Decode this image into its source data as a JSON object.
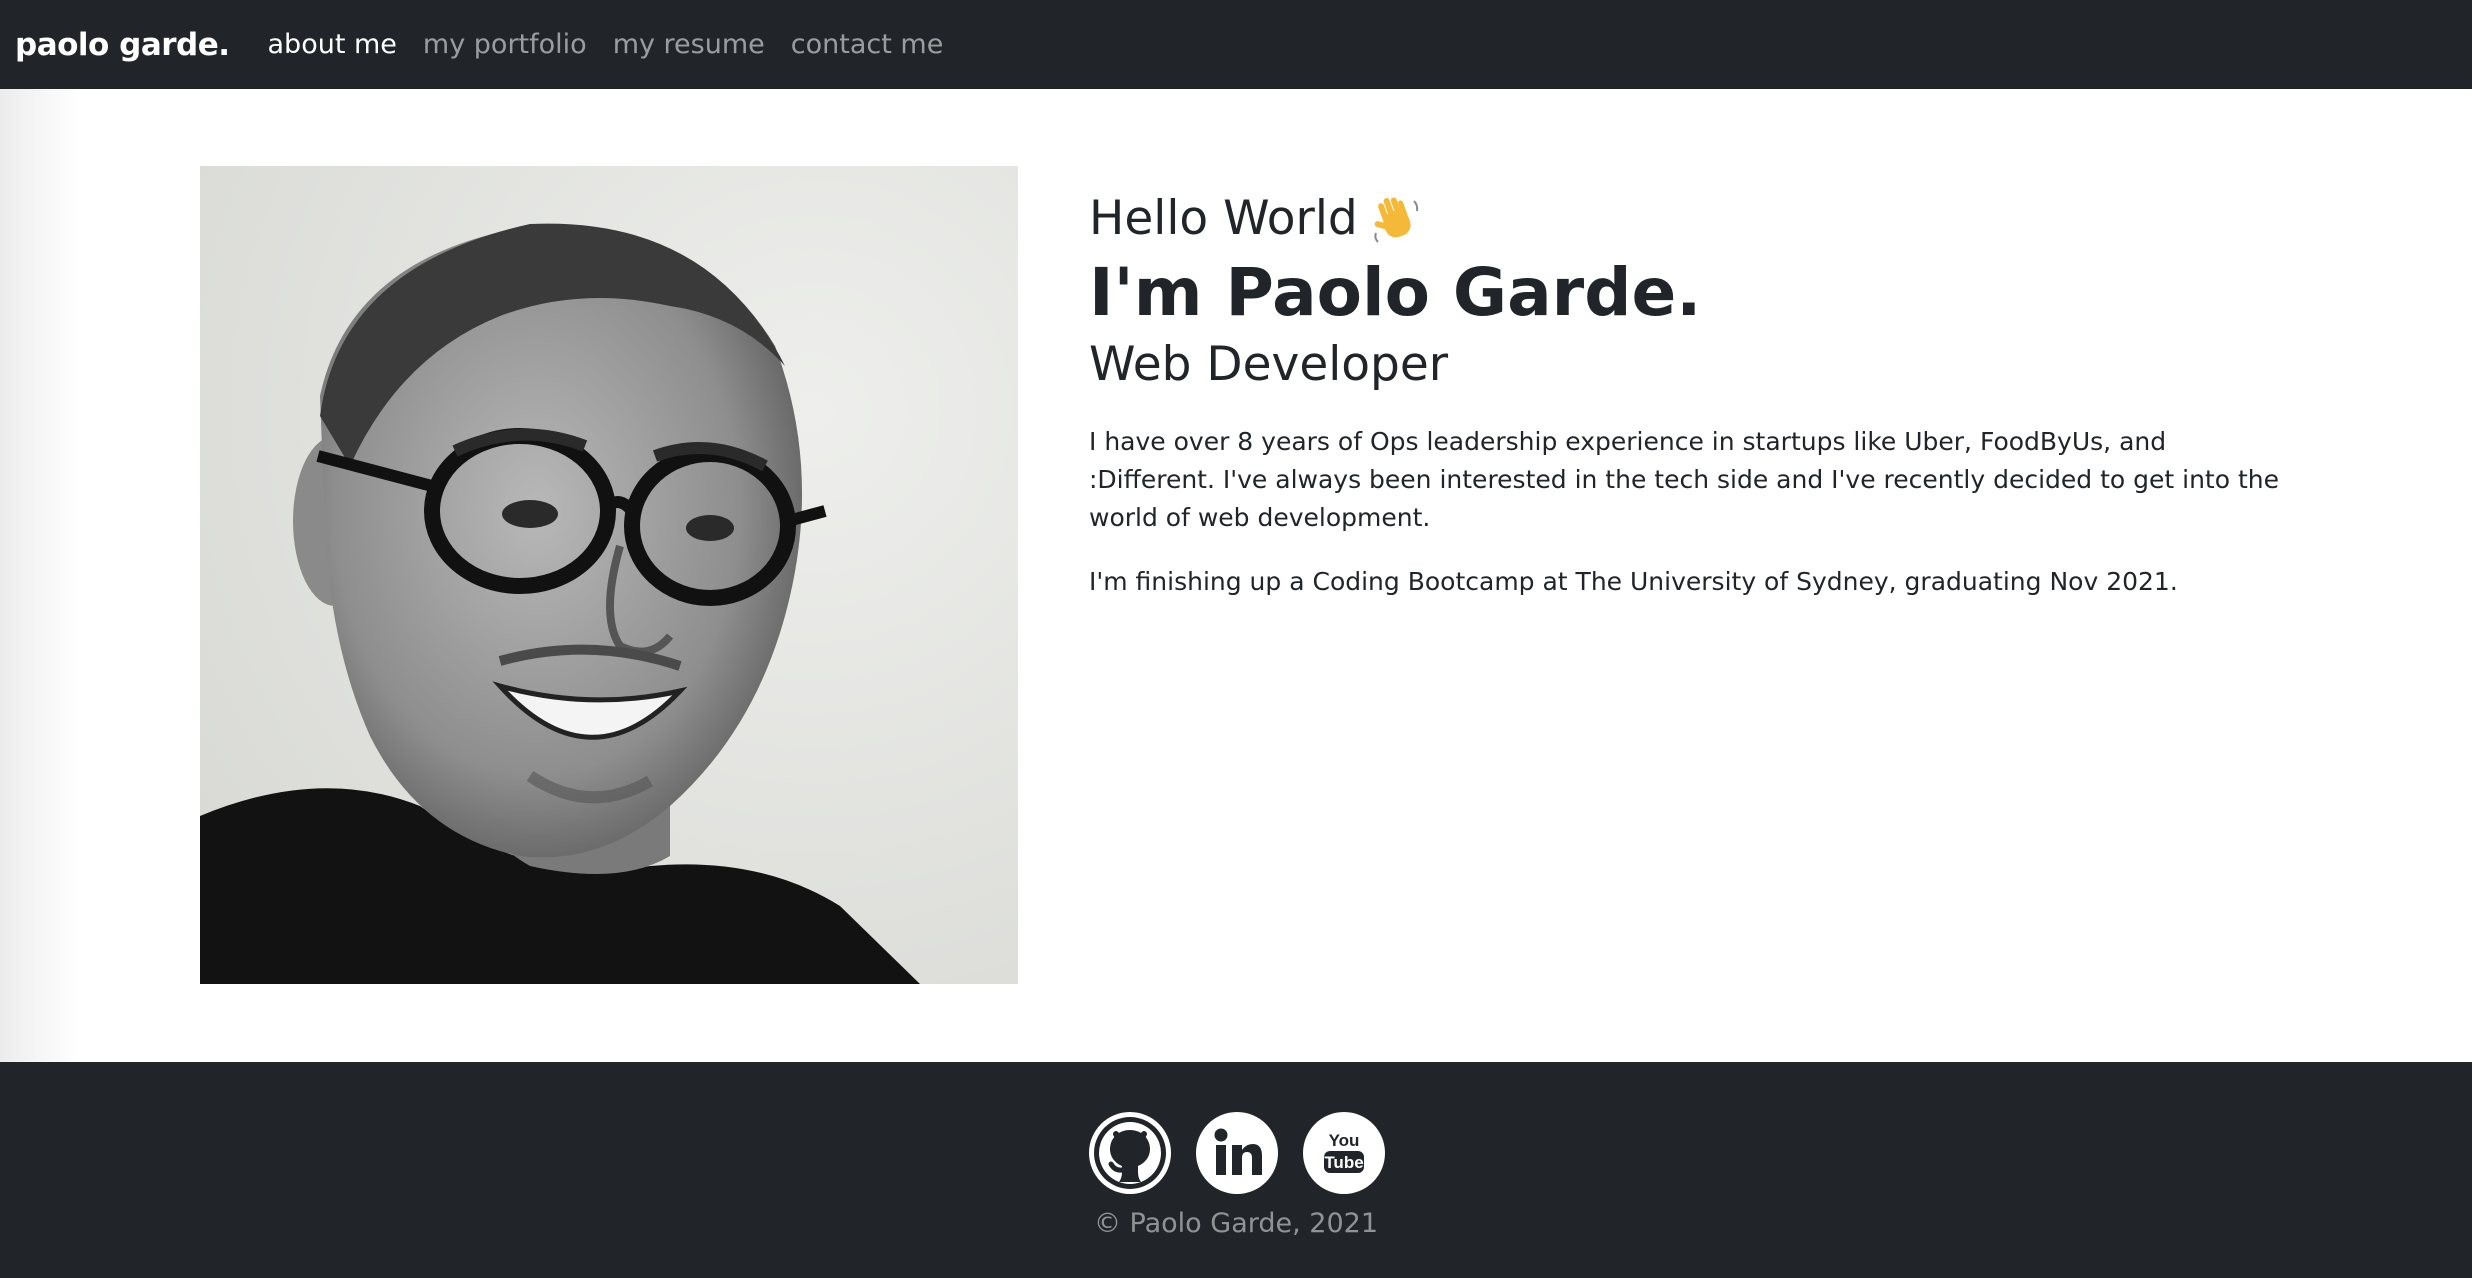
{
  "navbar": {
    "brand": "paolo garde.",
    "links": [
      {
        "label": "about me",
        "active": true
      },
      {
        "label": "my portfolio",
        "active": false
      },
      {
        "label": "my resume",
        "active": false
      },
      {
        "label": "contact me",
        "active": false
      }
    ]
  },
  "intro": {
    "greeting": "Hello World",
    "name": "I'm Paolo Garde.",
    "role": "Web Developer",
    "paragraphs": [
      "I have over 8 years of Ops leadership experience in startups like Uber, FoodByUs, and :Different. I've always been interested in the tech side and I've recently decided to get into the world of web development.",
      "I'm finishing up a Coding Bootcamp at The University of Sydney, graduating Nov 2021."
    ],
    "greeting_icon": "waving-hand-icon"
  },
  "footer": {
    "socials": [
      {
        "icon": "github-icon"
      },
      {
        "icon": "linkedin-icon"
      },
      {
        "icon": "youtube-icon",
        "text_top": "You",
        "text_bottom": "Tube"
      }
    ],
    "copyright": "© Paolo Garde, 2021"
  },
  "colors": {
    "navbar_bg": "#212529",
    "text": "#212529",
    "nav_muted": "#a6a8aa"
  }
}
